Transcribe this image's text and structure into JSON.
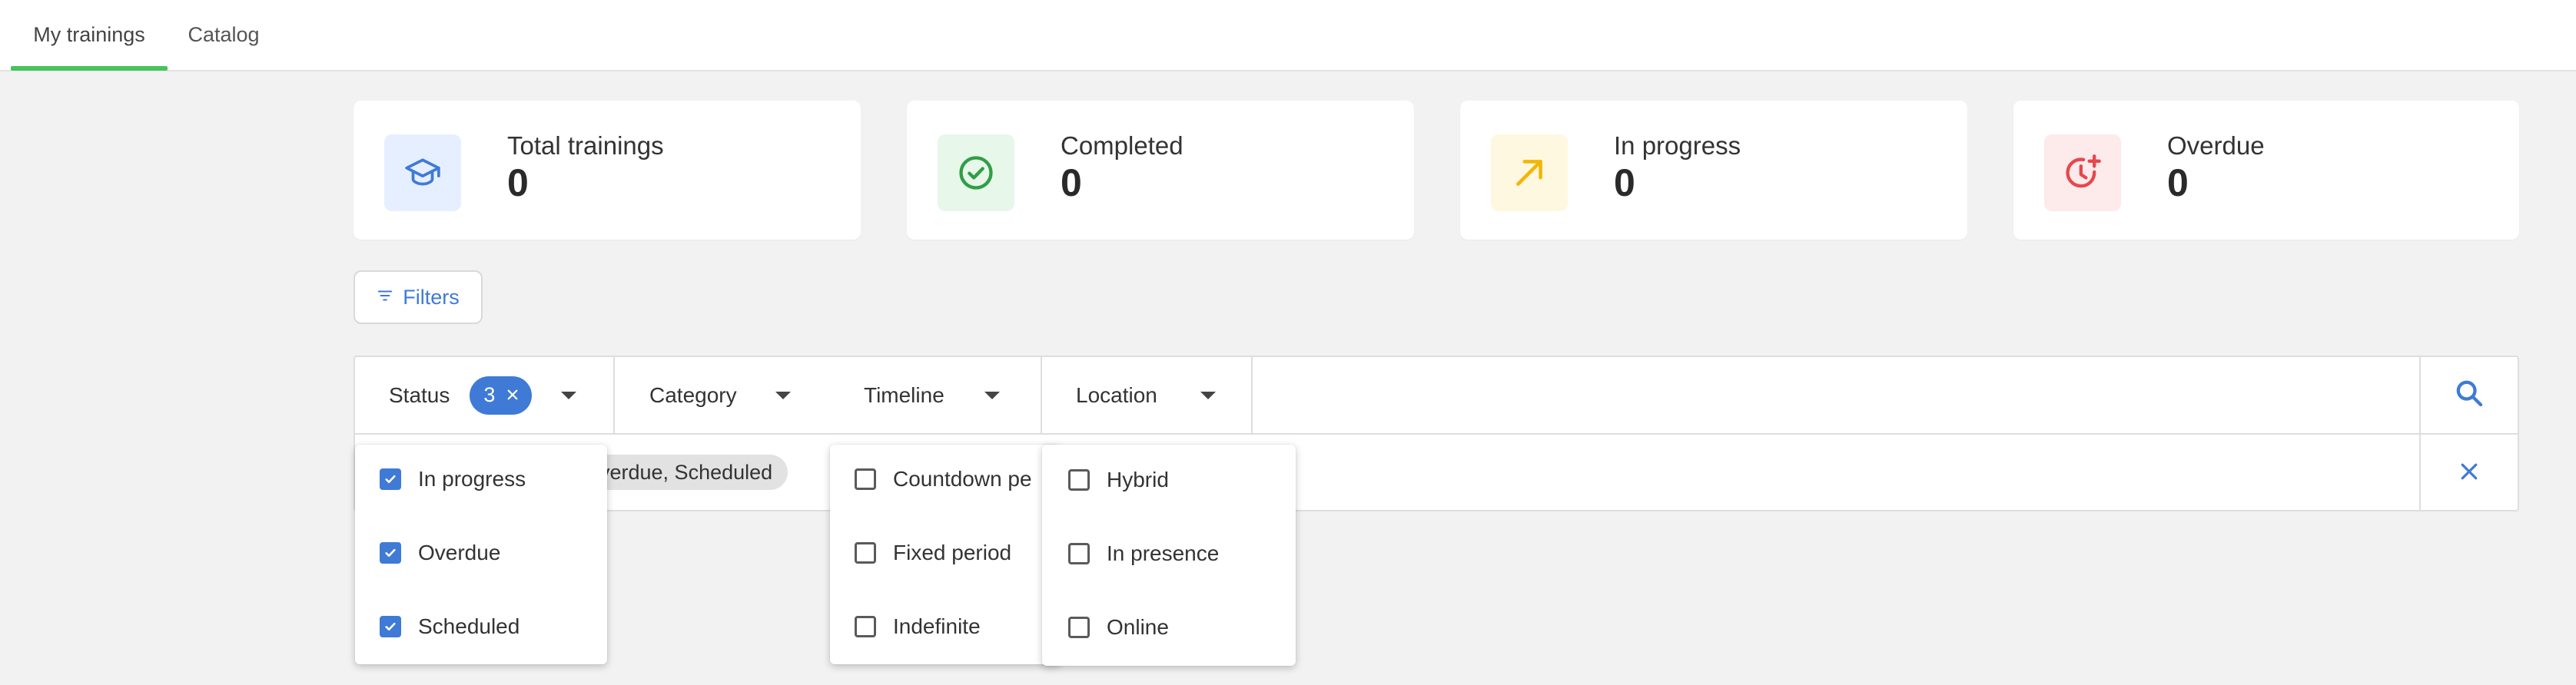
{
  "tabs": [
    {
      "label": "My trainings",
      "active": true
    },
    {
      "label": "Catalog",
      "active": false
    }
  ],
  "stats": [
    {
      "label": "Total trainings",
      "value": "0",
      "icon": "graduation-cap-icon",
      "color": "#3f7ad6",
      "bg": "#e6efff"
    },
    {
      "label": "Completed",
      "value": "0",
      "icon": "check-circle-icon",
      "color": "#2f9e44",
      "bg": "#e7f7ea"
    },
    {
      "label": "In progress",
      "value": "0",
      "icon": "arrow-up-right-icon",
      "color": "#f2b705",
      "bg": "#fff8e0"
    },
    {
      "label": "Overdue",
      "value": "0",
      "icon": "alarm-plus-icon",
      "color": "#e5484d",
      "bg": "#fdeaea"
    }
  ],
  "filters_button": {
    "label": "Filters",
    "icon": "filter-lines-icon"
  },
  "filter_bar": {
    "status": {
      "label": "Status",
      "count": "3"
    },
    "category": {
      "label": "Category"
    },
    "timeline": {
      "label": "Timeline"
    },
    "location": {
      "label": "Location"
    },
    "applied_chip": "verdue, Scheduled"
  },
  "dropdowns": {
    "status": [
      {
        "label": "In progress",
        "checked": true
      },
      {
        "label": "Overdue",
        "checked": true
      },
      {
        "label": "Scheduled",
        "checked": true
      }
    ],
    "timeline": [
      {
        "label": "Countdown pe",
        "checked": false
      },
      {
        "label": "Fixed period",
        "checked": false
      },
      {
        "label": "Indefinite",
        "checked": false
      }
    ],
    "location": [
      {
        "label": "Hybrid",
        "checked": false
      },
      {
        "label": "In presence",
        "checked": false
      },
      {
        "label": "Online",
        "checked": false
      }
    ]
  },
  "colors": {
    "accent": "#3f7ad6",
    "tab_indicator": "#46c35b"
  }
}
